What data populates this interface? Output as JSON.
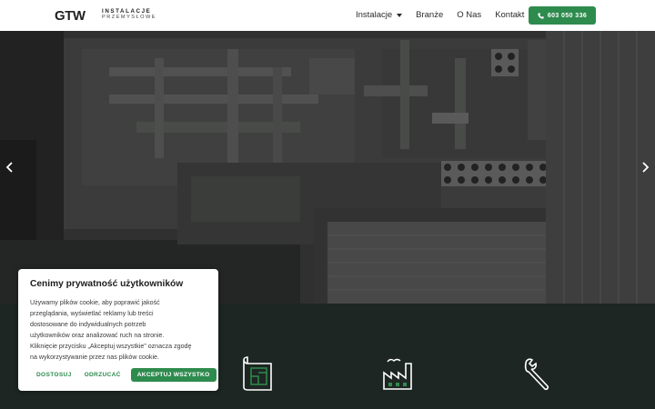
{
  "header": {
    "logo_mark": "GTW",
    "logo_line1": "INSTALACJE",
    "logo_line2": "PRZEMYSŁOWE",
    "nav": [
      {
        "label": "Instalacje"
      },
      {
        "label": "Branże"
      },
      {
        "label": "O Nas"
      },
      {
        "label": "Kontakt"
      }
    ],
    "phone": "603 050 336"
  },
  "colors": {
    "accent": "#2e8b4e",
    "dark_section": "#1d2622",
    "header_bg": "#ffffff"
  },
  "services_icons": [
    "blueprint-icon",
    "factory-icon",
    "wrench-icon"
  ],
  "cookie": {
    "title": "Cenimy prywatność użytkowników",
    "lines": [
      "Używamy plików cookie, aby poprawić jakość",
      "przeglądania, wyświetlać reklamy lub treści",
      "dostosowane do indywidualnych potrzeb",
      "użytkowników oraz analizować ruch na stronie.",
      "Kliknięcie przycisku „Akceptuj wszystkie” oznacza zgodę",
      "na wykorzystywanie przez nas plików cookie."
    ],
    "customize": "DOSTOSUJ",
    "reject": "ODRZUCAĆ",
    "accept": "AKCEPTUJ WSZYSTKO"
  }
}
